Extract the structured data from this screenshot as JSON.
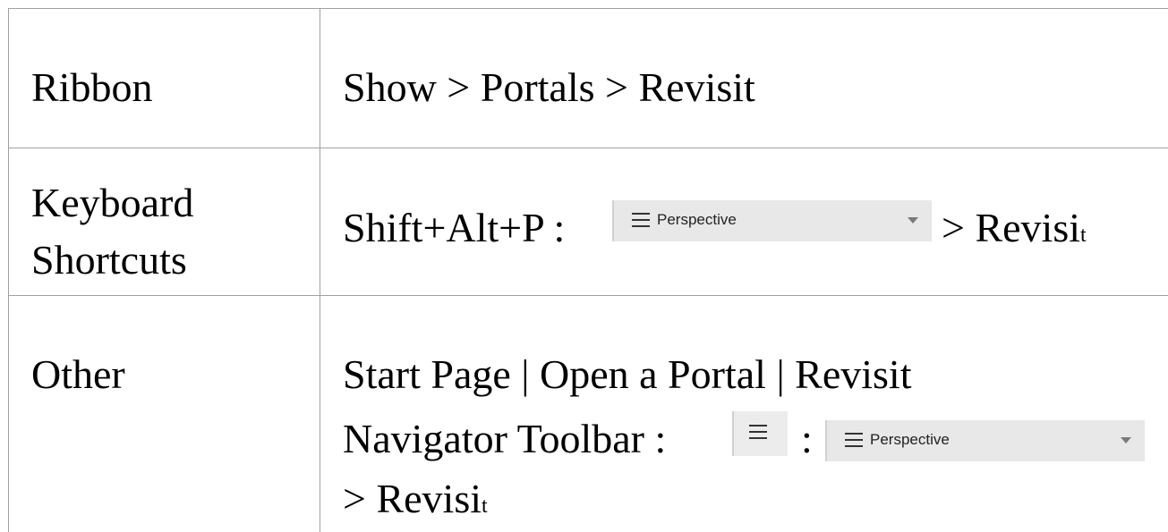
{
  "rows": [
    {
      "label": "Ribbon",
      "value": "Show > Portals > Revisit"
    },
    {
      "label_line1": "Keyboard",
      "label_line2": "Shortcuts",
      "value_prefix": "Shift+Alt+P :",
      "dropdown_label": "Perspective",
      "value_suffix_main": "> Revisi",
      "value_suffix_sub": "t"
    },
    {
      "label": "Other",
      "line1": "Start Page | Open a Portal | Revisit",
      "line2_prefix": "Navigator Toolbar :",
      "line2_separator": ":",
      "dropdown_label": "Perspective",
      "line3_main": "> Revisi",
      "line3_sub": "t"
    }
  ],
  "icons": {
    "menu": "hamburger-menu-icon",
    "dropdown": "chevron-down-icon"
  }
}
